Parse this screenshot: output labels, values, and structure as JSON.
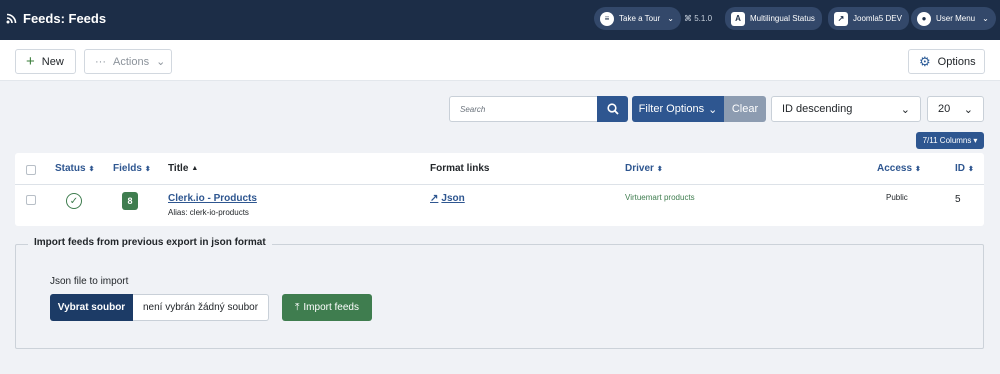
{
  "header": {
    "title": "Feeds: Feeds",
    "tour_label": "Take a Tour",
    "version": "5.1.0",
    "multilingual_label": "Multilingual Status",
    "site_label": "Joomla5 DEV",
    "user_menu_label": "User Menu"
  },
  "toolbar": {
    "new_label": "New",
    "actions_label": "Actions",
    "options_label": "Options"
  },
  "filters": {
    "search_placeholder": "Search",
    "filter_options_label": "Filter Options",
    "clear_label": "Clear",
    "ordering_value": "ID descending",
    "limit_value": "20",
    "columns_label": "7/11 Columns"
  },
  "table": {
    "headers": {
      "status": "Status",
      "fields": "Fields",
      "title": "Title",
      "format_links": "Format links",
      "driver": "Driver",
      "access": "Access",
      "id": "ID"
    },
    "rows": [
      {
        "fields_count": "8",
        "title": "Clerk.io - Products",
        "alias": "Alias: clerk-io-products",
        "format_link": "Json",
        "driver": "Virtuemart products",
        "access": "Public",
        "id": "5"
      }
    ]
  },
  "import": {
    "legend": "Import feeds from previous export in json format",
    "file_label": "Json file to import",
    "choose_file_label": "Vybrat soubor",
    "no_file_label": "není vybrán žádný soubor",
    "import_button_label": "Import feeds"
  },
  "colors": {
    "header_bg": "#1c2d47",
    "primary": "#2e5690",
    "success": "#3f7d4f"
  }
}
